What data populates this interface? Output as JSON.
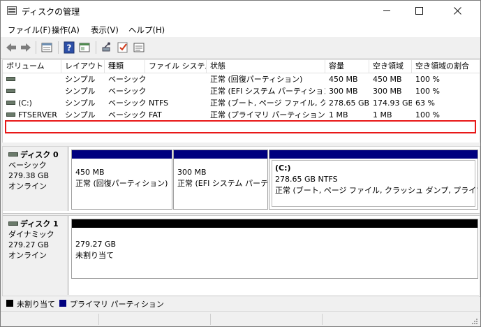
{
  "window": {
    "title": "ディスクの管理"
  },
  "menu": [
    {
      "label": "ファイル(F)"
    },
    {
      "label": "操作(A)"
    },
    {
      "label": "表示(V)"
    },
    {
      "label": "ヘルプ(H)"
    }
  ],
  "toolbar": {
    "icons": [
      "back-arrow-icon",
      "forward-arrow-icon",
      "disk-list-icon",
      "help-icon",
      "console-icon",
      "connect-icon",
      "checkmark-icon",
      "properties-icon"
    ]
  },
  "volume_table": {
    "headers": [
      "ボリューム",
      "レイアウト",
      "種類",
      "ファイル システム",
      "状態",
      "容量",
      "空き領域",
      "空き領域の割合"
    ],
    "rows": [
      {
        "volume": "",
        "layout": "シンプル",
        "type": "ベーシック",
        "fs": "",
        "status": "正常 (回復パーティション)",
        "capacity": "450 MB",
        "free": "450 MB",
        "pct": "100 %"
      },
      {
        "volume": "",
        "layout": "シンプル",
        "type": "ベーシック",
        "fs": "",
        "status": "正常 (EFI システム パーティション)",
        "capacity": "300 MB",
        "free": "300 MB",
        "pct": "100 %"
      },
      {
        "volume": "(C:)",
        "layout": "シンプル",
        "type": "ベーシック",
        "fs": "NTFS",
        "status": "正常 (ブート, ページ ファイル, クラ...",
        "capacity": "278.65 GB",
        "free": "174.93 GB",
        "pct": "63 %"
      },
      {
        "volume": "FTSERVER",
        "layout": "シンプル",
        "type": "ベーシック",
        "fs": "FAT",
        "status": "正常 (プライマリ パーティション)",
        "capacity": "1 MB",
        "free": "1 MB",
        "pct": "100 %"
      }
    ]
  },
  "disks": [
    {
      "name": "ディスク 0",
      "kind": "ベーシック",
      "size": "279.38 GB",
      "state": "オンライン",
      "partitions": [
        {
          "title": "",
          "size": "450 MB",
          "status": "正常 (回復パーティション)"
        },
        {
          "title": "",
          "size": "300 MB",
          "status": "正常 (EFI システム パーティ"
        },
        {
          "title": "(C:)",
          "size": "278.65 GB NTFS",
          "status": "正常 (ブート, ページ ファイル, クラッシュ ダンプ, プライマリ パーティ"
        }
      ]
    },
    {
      "name": "ディスク 1",
      "kind": "ダイナミック",
      "size": "279.27 GB",
      "state": "オンライン",
      "partitions": [
        {
          "title": "",
          "size": "279.27 GB",
          "status": "未割り当て"
        }
      ]
    }
  ],
  "legend": [
    {
      "label": "未割り当て",
      "color": "#000000"
    },
    {
      "label": "プライマリ パーティション",
      "color": "#00007f"
    }
  ],
  "colors": {
    "primary_bar": "#00007f",
    "unallocated_bar": "#000000",
    "highlight": "#e81818"
  }
}
